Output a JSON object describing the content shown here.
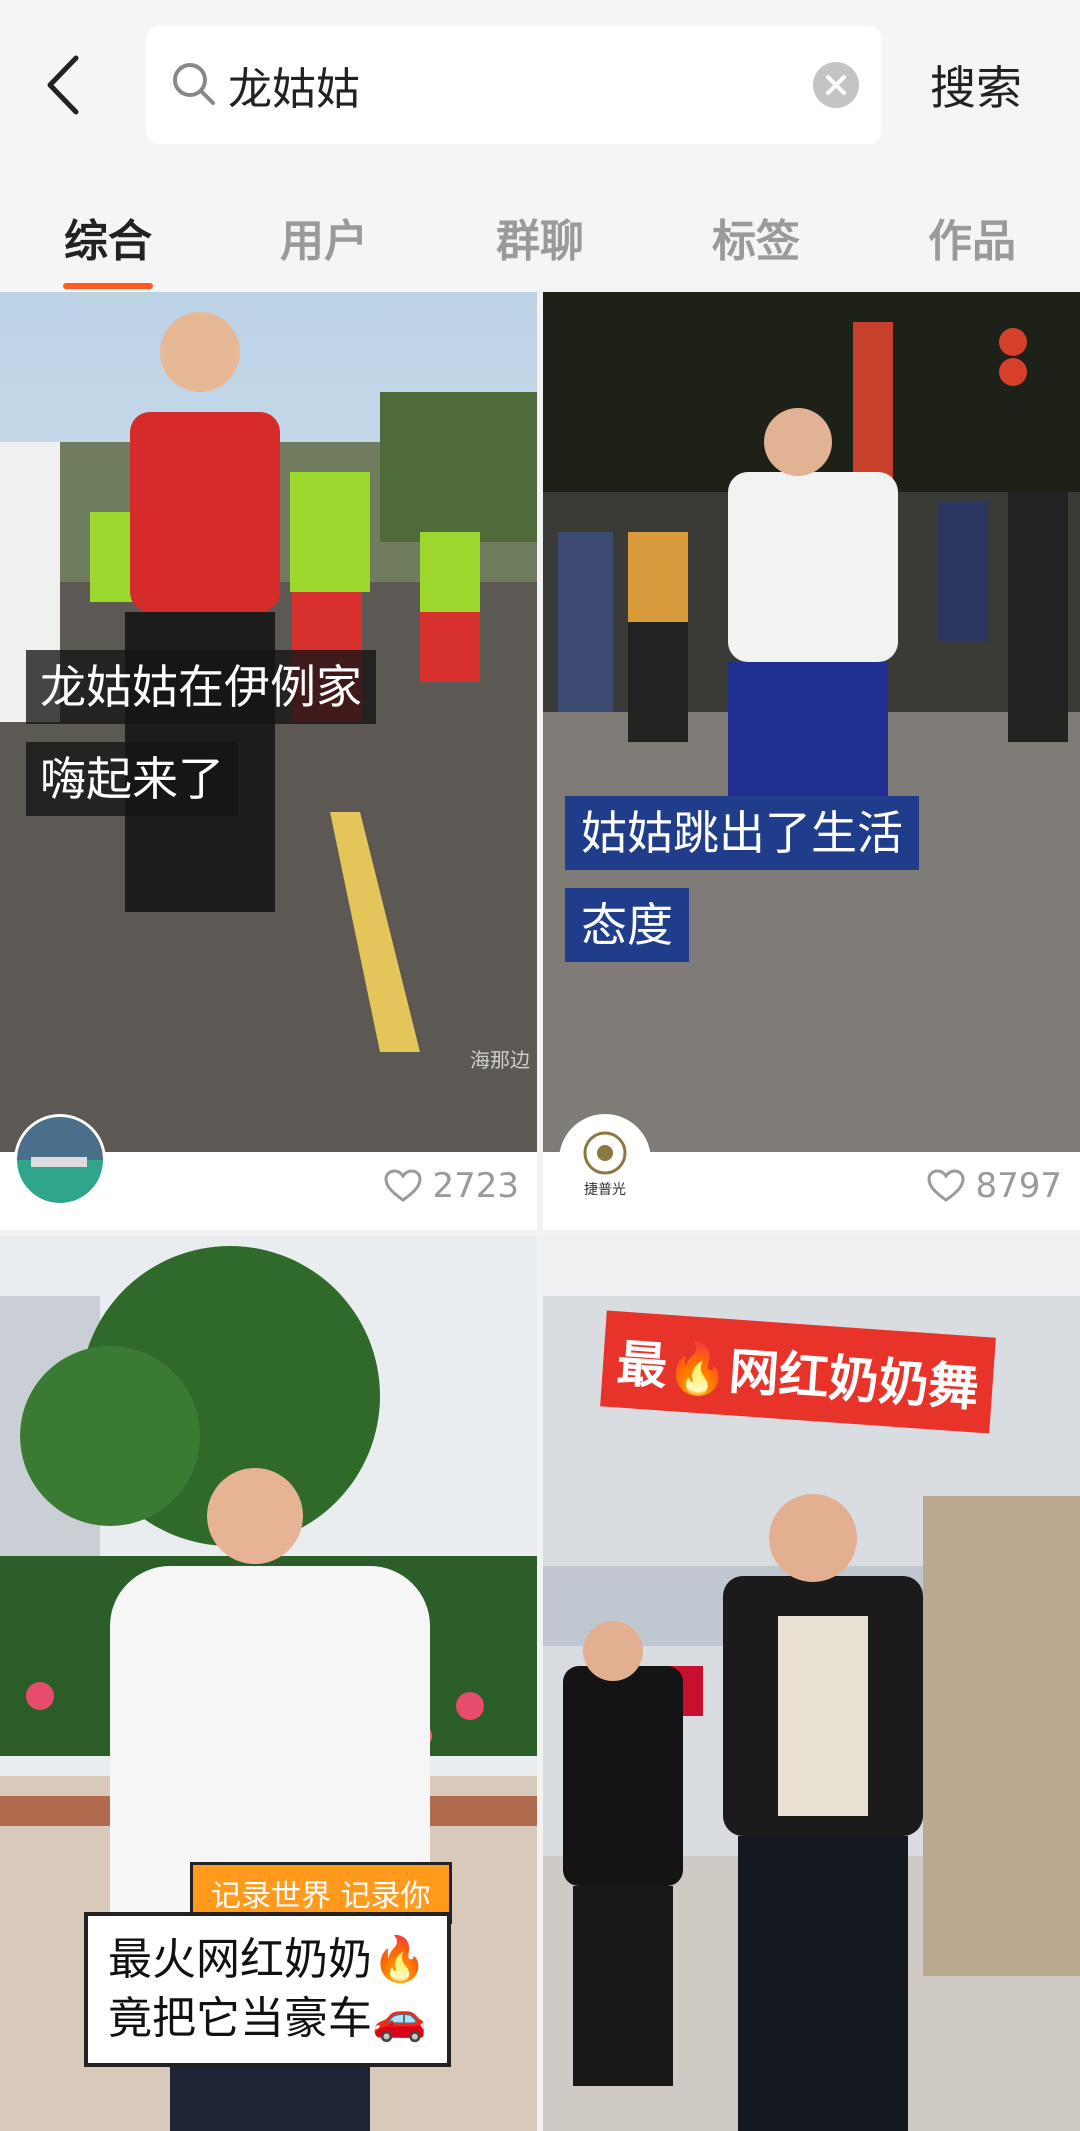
{
  "header": {
    "search_value": "龙姑姑",
    "search_button": "搜索"
  },
  "tabs": [
    "综合",
    "用户",
    "群聊",
    "标签",
    "作品"
  ],
  "active_tab": 0,
  "cards": [
    {
      "caption_lines": [
        "龙姑姑在伊例家",
        "嗨起来了"
      ],
      "likes": "2723",
      "watermark": "海那边"
    },
    {
      "caption_lines": [
        "姑姑跳出了生活",
        "态度"
      ],
      "likes": "8797",
      "avatar_text": "捷普光"
    },
    {
      "orange_tag": "记录世界 记录你",
      "caption_lines": [
        "最火网红奶奶🔥",
        "竟把它当豪车🚗"
      ]
    },
    {
      "banner": "最🔥网红奶奶舞"
    }
  ],
  "colors": {
    "accent": "#ff5a1f",
    "caption_blue": "#1f3d8a",
    "banner_red": "#e8332a"
  }
}
